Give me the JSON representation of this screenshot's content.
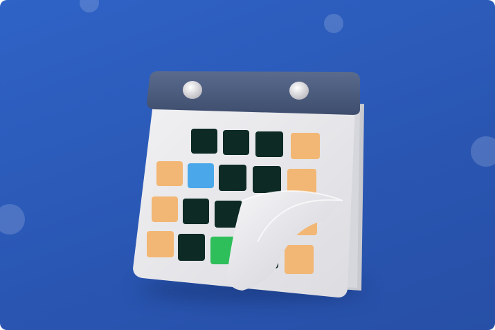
{
  "illustration": {
    "subject": "calendar-icon",
    "colors": {
      "background": "#2b58b8",
      "binder": "#4a5a7c",
      "page": "#e9e9ec",
      "day_dark": "#0d2a24",
      "day_orange": "#f2b774",
      "day_blue": "#4aa8ea",
      "day_green": "#2fbf5a",
      "ring": "#d8d8dc"
    }
  }
}
